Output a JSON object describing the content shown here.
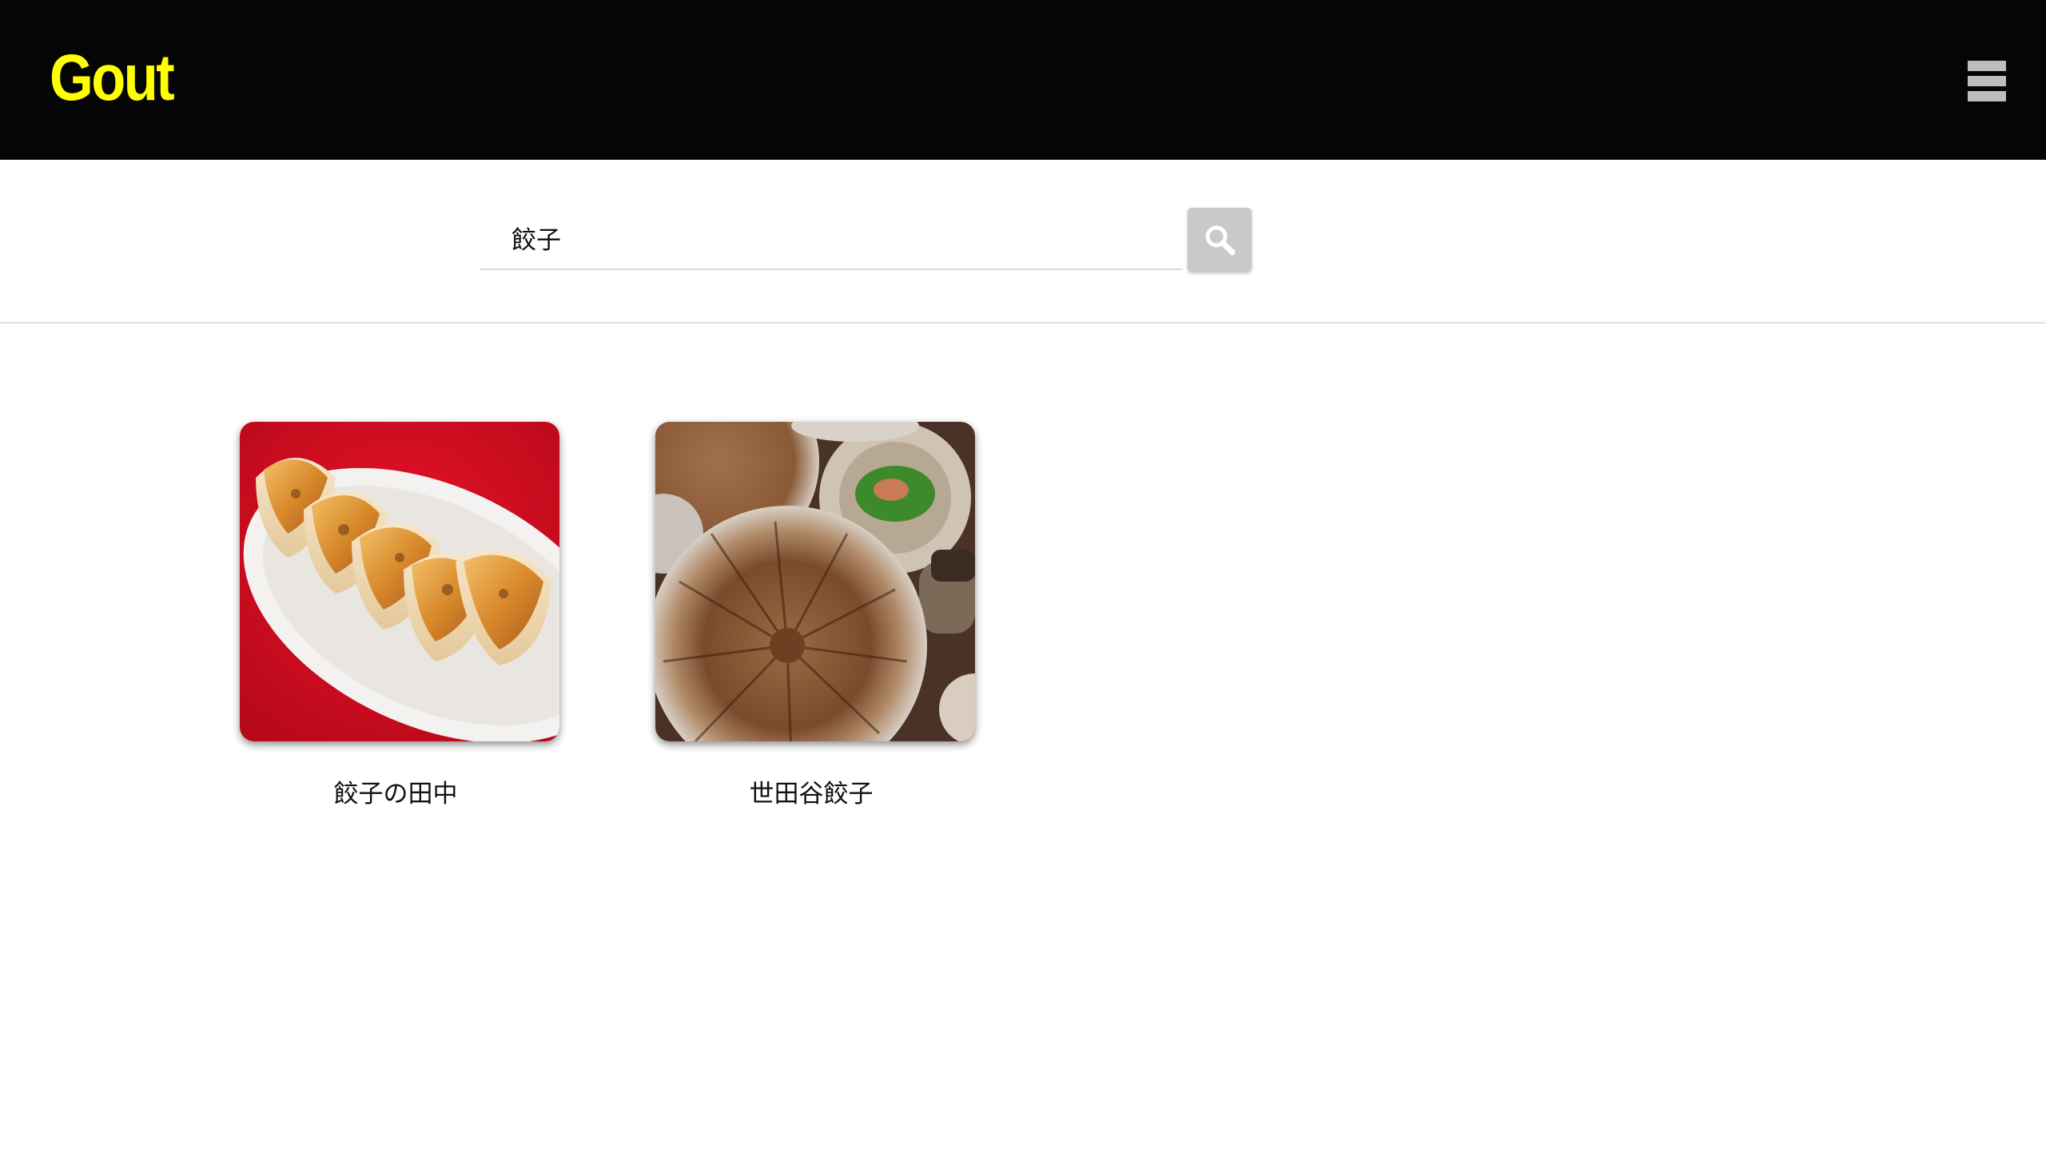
{
  "header": {
    "logo": "Gout",
    "logo_color": "#ffff00",
    "background": "#050505",
    "menu_icon": "hamburger-menu-icon"
  },
  "search": {
    "value": "餃子",
    "button_icon": "search-icon"
  },
  "results": [
    {
      "name": "餃子の田中",
      "image": "gyoza-plate-on-red-table"
    },
    {
      "name": "世田谷餃子",
      "image": "gyoza-round-plate-with-side-dishes"
    }
  ]
}
